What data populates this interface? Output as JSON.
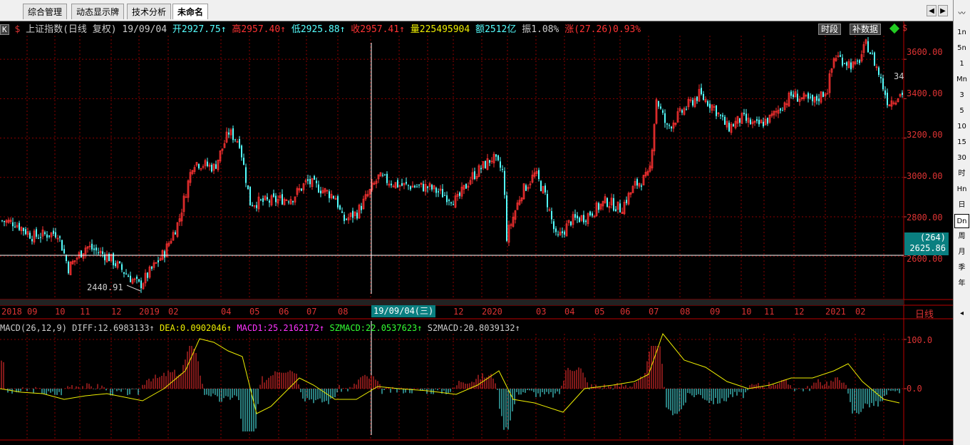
{
  "tabs": [
    {
      "label": "综合管理",
      "active": false
    },
    {
      "label": "动态显示牌",
      "active": false
    },
    {
      "label": "技术分析",
      "active": false
    },
    {
      "label": "未命名",
      "active": true
    }
  ],
  "tab_nav": {
    "left": "◀",
    "right": "▶"
  },
  "header": {
    "k_icon": "K",
    "dollar": "$",
    "title": "上证指数(日线 复权)",
    "date": "19/09/04",
    "open_label": "开",
    "open": "2927.75",
    "high_label": "高",
    "high": "2957.40",
    "low_label": "低",
    "low": "2925.88",
    "close_label": "收",
    "close": "2957.41",
    "vol_label": "量",
    "vol": "225495904",
    "amt_label": "额",
    "amt": "2512亿",
    "amp_label": "振",
    "amp": "1.08%",
    "chg_label": "涨",
    "chg": "(27.26)0.93%",
    "arrow": "↑"
  },
  "badges": {
    "timeseg": "时段",
    "supplement": "补数据"
  },
  "right_toolbar": [
    "1n",
    "5n",
    "1",
    "Mn",
    "3",
    "5",
    "10",
    "15",
    "30",
    "时",
    "Hn",
    "日",
    "Dn",
    "周",
    "月",
    "季",
    "年"
  ],
  "right_toolbar_selected": "日",
  "y_axis": [
    "3600.00",
    "3400.00",
    "3200.00",
    "3000.00",
    "2800.00",
    "2600.00"
  ],
  "cursor_box": {
    "count": "(264)",
    "price": "2625.86"
  },
  "edge_marker": "34",
  "low_annotation": "2440.91",
  "date_box": "19/09/04(三)",
  "x_axis": [
    "2018",
    "09",
    "10",
    "11",
    "12",
    "2019",
    "02",
    "04",
    "05",
    "06",
    "07",
    "08",
    "12",
    "2020",
    "03",
    "04",
    "05",
    "06",
    "07",
    "08",
    "09",
    "10",
    "11",
    "12",
    "2021",
    "02"
  ],
  "period_label": "日线",
  "macd": {
    "name": "MACD(26,12,9)",
    "diff": "DIFF:12.6983133",
    "dea": "DEA:0.0902046",
    "macd1": "MACD1:25.2162172",
    "szmacd": "SZMACD:22.0537623",
    "s2macd": "S2MACD:20.8039132",
    "arrow": "↑",
    "y_axis": [
      "100.0",
      "0.0"
    ]
  },
  "colors": {
    "up": "#ff3232",
    "down": "#54ffff",
    "grid": "#8b0000",
    "axis_text": "#d33",
    "accent": "#0a7f80"
  },
  "chart_data": {
    "type": "candlestick",
    "title": "上证指数(日线 复权)",
    "ylim": [
      2380,
      3720
    ],
    "x_ticks": [
      "2018",
      "09",
      "10",
      "11",
      "12",
      "2019",
      "02",
      "04",
      "05",
      "06",
      "07",
      "08",
      "12",
      "2020",
      "03",
      "04",
      "05",
      "06",
      "07",
      "08",
      "09",
      "10",
      "11",
      "12",
      "2021",
      "02"
    ],
    "price_path": [
      [
        0,
        2780
      ],
      [
        20,
        2770
      ],
      [
        45,
        2700
      ],
      [
        80,
        2720
      ],
      [
        95,
        2540
      ],
      [
        120,
        2650
      ],
      [
        150,
        2600
      ],
      [
        185,
        2480
      ],
      [
        195,
        2450
      ],
      [
        230,
        2620
      ],
      [
        250,
        2780
      ],
      [
        270,
        3080
      ],
      [
        300,
        3050
      ],
      [
        320,
        3230
      ],
      [
        335,
        3180
      ],
      [
        350,
        2870
      ],
      [
        380,
        2880
      ],
      [
        410,
        2900
      ],
      [
        430,
        2980
      ],
      [
        470,
        2900
      ],
      [
        480,
        2780
      ],
      [
        500,
        2820
      ],
      [
        530,
        3000
      ],
      [
        560,
        2960
      ],
      [
        600,
        2950
      ],
      [
        640,
        2880
      ],
      [
        660,
        3000
      ],
      [
        690,
        3100
      ],
      [
        705,
        3030
      ],
      [
        710,
        2700
      ],
      [
        730,
        2920
      ],
      [
        750,
        3020
      ],
      [
        765,
        2900
      ],
      [
        780,
        2680
      ],
      [
        800,
        2780
      ],
      [
        820,
        2800
      ],
      [
        850,
        2880
      ],
      [
        870,
        2840
      ],
      [
        890,
        2960
      ],
      [
        910,
        3010
      ],
      [
        920,
        3400
      ],
      [
        935,
        3250
      ],
      [
        960,
        3350
      ],
      [
        980,
        3420
      ],
      [
        1000,
        3360
      ],
      [
        1020,
        3250
      ],
      [
        1040,
        3300
      ],
      [
        1060,
        3260
      ],
      [
        1080,
        3300
      ],
      [
        1110,
        3420
      ],
      [
        1140,
        3380
      ],
      [
        1160,
        3450
      ],
      [
        1170,
        3620
      ],
      [
        1200,
        3560
      ],
      [
        1215,
        3680
      ],
      [
        1230,
        3550
      ],
      [
        1245,
        3380
      ],
      [
        1265,
        3430
      ]
    ],
    "macd_dea_path": [
      [
        0,
        545
      ],
      [
        30,
        550
      ],
      [
        60,
        552
      ],
      [
        90,
        560
      ],
      [
        120,
        555
      ],
      [
        150,
        552
      ],
      [
        200,
        562
      ],
      [
        230,
        545
      ],
      [
        260,
        520
      ],
      [
        280,
        475
      ],
      [
        300,
        480
      ],
      [
        320,
        492
      ],
      [
        340,
        500
      ],
      [
        360,
        580
      ],
      [
        380,
        570
      ],
      [
        400,
        550
      ],
      [
        420,
        530
      ],
      [
        440,
        540
      ],
      [
        470,
        560
      ],
      [
        500,
        560
      ],
      [
        530,
        542
      ],
      [
        560,
        545
      ],
      [
        600,
        548
      ],
      [
        640,
        553
      ],
      [
        670,
        540
      ],
      [
        700,
        520
      ],
      [
        720,
        560
      ],
      [
        750,
        565
      ],
      [
        790,
        578
      ],
      [
        820,
        545
      ],
      [
        860,
        540
      ],
      [
        890,
        535
      ],
      [
        910,
        525
      ],
      [
        930,
        468
      ],
      [
        960,
        505
      ],
      [
        990,
        515
      ],
      [
        1020,
        535
      ],
      [
        1050,
        545
      ],
      [
        1080,
        540
      ],
      [
        1110,
        530
      ],
      [
        1140,
        530
      ],
      [
        1170,
        520
      ],
      [
        1190,
        510
      ],
      [
        1210,
        535
      ],
      [
        1240,
        560
      ],
      [
        1262,
        565
      ]
    ]
  }
}
